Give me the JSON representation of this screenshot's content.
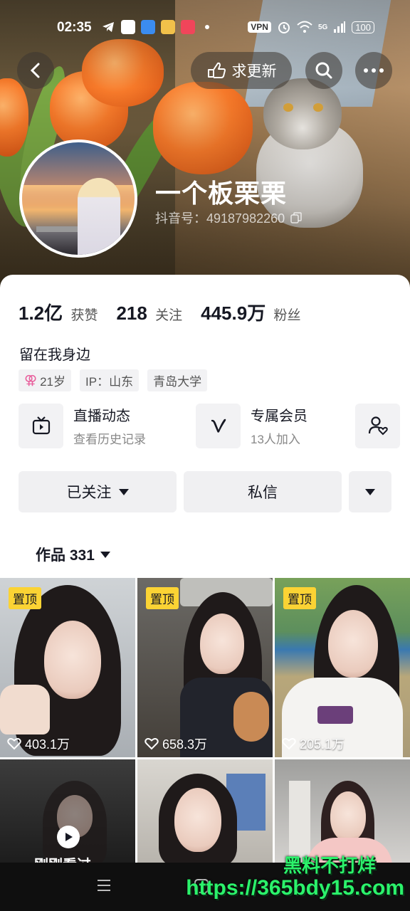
{
  "status_bar": {
    "time": "02:35",
    "vpn": "VPN",
    "network": "5G",
    "battery": "100"
  },
  "nav": {
    "request_update": "求更新"
  },
  "profile": {
    "nickname": "一个板栗栗",
    "douyin_id": "抖音号：49187982260",
    "likes_count": "1.2亿",
    "likes_label": "获赞",
    "following_count": "218",
    "following_label": "关注",
    "followers_count": "445.9万",
    "followers_label": "粉丝",
    "bio": "留在我身边",
    "tags": {
      "age": "21岁",
      "ip": "IP：山东",
      "school": "青岛大学"
    }
  },
  "features": {
    "live": {
      "title": "直播动态",
      "subtitle": "查看历史记录"
    },
    "member": {
      "title": "专属会员",
      "subtitle": "13人加入"
    }
  },
  "actions": {
    "follow": "已关注",
    "message": "私信"
  },
  "works_tab": {
    "label": "作品 331"
  },
  "videos": [
    {
      "pinned": "置顶",
      "likes": "403.1万"
    },
    {
      "pinned": "置顶",
      "likes": "658.3万"
    },
    {
      "pinned": "置顶",
      "likes": "205.1万"
    },
    {
      "overlay": "刚刚看过"
    },
    {},
    {}
  ],
  "watermark": {
    "line1": "黑料不打烊",
    "line2": "https://365bdy15.com"
  },
  "colors": {
    "accent": "#fbd334",
    "text": "#161823",
    "watermark": "#2bf26b"
  }
}
